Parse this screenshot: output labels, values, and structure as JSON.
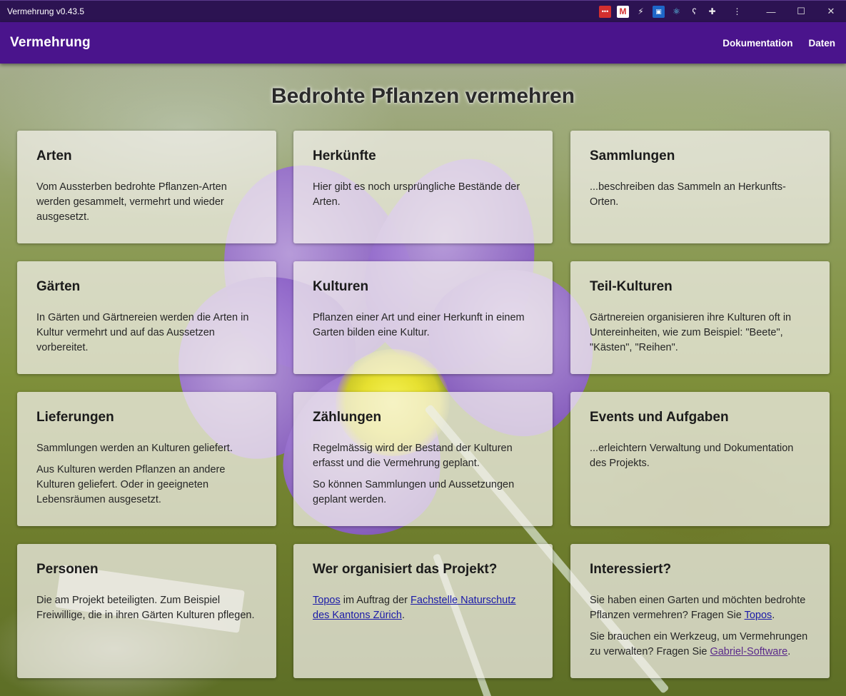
{
  "window": {
    "title": "Vermehrung v0.43.5",
    "extensions": [
      "password-manager-icon",
      "gmail-icon",
      "lightning-icon",
      "window-icon",
      "react-icon",
      "bear-icon",
      "puzzle-icon",
      "more-vertical-icon"
    ],
    "controls": [
      "minimize",
      "maximize",
      "close"
    ]
  },
  "appbar": {
    "title": "Vermehrung",
    "nav": [
      "Dokumentation",
      "Daten"
    ],
    "color": "#4a148c"
  },
  "heading": "Bedrohte Pflanzen vermehren",
  "cards": {
    "arten": {
      "title": "Arten",
      "text": "Vom Aussterben bedrohte Pflanzen-Arten werden gesammelt, vermehrt und wieder ausgesetzt."
    },
    "herkuenfte": {
      "title": "Herkünfte",
      "text": "Hier gibt es noch ursprüngliche Bestände der Arten."
    },
    "sammlungen": {
      "title": "Sammlungen",
      "text": "...beschreiben das Sammeln an Herkunfts-Orten."
    },
    "gaerten": {
      "title": "Gärten",
      "text": "In Gärten und Gärtnereien werden die Arten in Kultur vermehrt und auf das Aussetzen vorbereitet."
    },
    "kulturen": {
      "title": "Kulturen",
      "text": "Pflanzen einer Art und einer Herkunft in einem Garten bilden eine Kultur."
    },
    "teilkulturen": {
      "title": "Teil-Kulturen",
      "text": "Gärtnereien organisieren ihre Kulturen oft in Untereinheiten, wie zum Beispiel: \"Beete\", \"Kästen\", \"Reihen\"."
    },
    "lieferungen": {
      "title": "Lieferungen",
      "text1": "Sammlungen werden an Kulturen geliefert.",
      "text2": "Aus Kulturen werden Pflanzen an andere Kulturen geliefert. Oder in geeigneten Lebensräumen ausgesetzt."
    },
    "zaehlungen": {
      "title": "Zählungen",
      "text1": "Regelmässig wird der Bestand der Kulturen erfasst und die Vermehrung geplant.",
      "text2": "So können Sammlungen und Aussetzungen geplant werden."
    },
    "events": {
      "title": "Events und Aufgaben",
      "text": "...erleichtern Verwaltung und Dokumentation des Projekts."
    },
    "personen": {
      "title": "Personen",
      "text": "Die am Projekt beteiligten. Zum Beispiel Freiwillige, die in ihren Gärten Kulturen pflegen."
    },
    "organisation": {
      "title": "Wer organisiert das Projekt?",
      "link1": "Topos",
      "mid": " im Auftrag der ",
      "link2": "Fachstelle Naturschutz des Kantons Zürich",
      "end": "."
    },
    "interessiert": {
      "title": "Interessiert?",
      "p1_text": "Sie haben einen Garten und möchten bedrohte Pflanzen vermehren? Fragen Sie ",
      "p1_link": "Topos",
      "p1_end": ".",
      "p2_text": "Sie brauchen ein Werkzeug, um Vermehrungen zu verwalten? Fragen Sie ",
      "p2_link": "Gabriel-Software",
      "p2_end": "."
    }
  }
}
